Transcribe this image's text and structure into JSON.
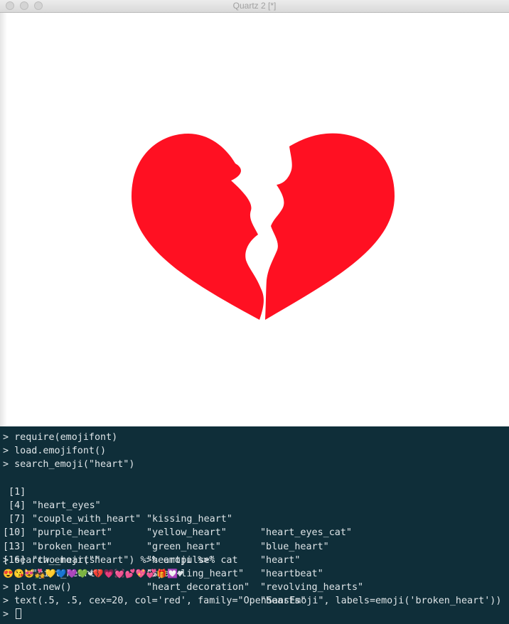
{
  "window": {
    "title": "Quartz 2 [*]"
  },
  "plot": {
    "glyph": "broken-heart",
    "color": "#ff1022"
  },
  "console": {
    "prompt": ">",
    "commands": [
      "require(emojifont)",
      "load.emojifont()",
      "search_emoji(\"heart\")"
    ],
    "results": [
      {
        "index": " [1]",
        "values": [
          "\"heart_eyes\"",
          "\"kissing_heart\"",
          "\"heart_eyes_cat\""
        ]
      },
      {
        "index": " [4]",
        "values": [
          "\"couple_with_heart\"",
          "\"yellow_heart\"",
          "\"blue_heart\""
        ]
      },
      {
        "index": " [7]",
        "values": [
          "\"purple_heart\"",
          "\"green_heart\"",
          "\"heart\""
        ]
      },
      {
        "index": "[10]",
        "values": [
          "\"broken_heart\"",
          "\"heartpulse\"",
          "\"heartbeat\""
        ]
      },
      {
        "index": "[13]",
        "values": [
          "\"two_hearts\"",
          "\"sparkling_heart\"",
          "\"revolving_hearts\""
        ]
      },
      {
        "index": "[16]",
        "values": [
          "\"gift_heart\"",
          "\"heart_decoration\"",
          "\"hearts\""
        ]
      }
    ],
    "command_emoji": "search_emoji(\"heart\") %>% emoji %>% cat",
    "emoji_output": "😍😘😻💑💛💙💜💚❤💔💗💓💕💖💞🎁💟♥",
    "command_plot": "plot.new()",
    "command_text": "text(.5, .5, cex=20, col='red', family=\"OpenSansEmoji\", labels=emoji('broken_heart'))"
  }
}
